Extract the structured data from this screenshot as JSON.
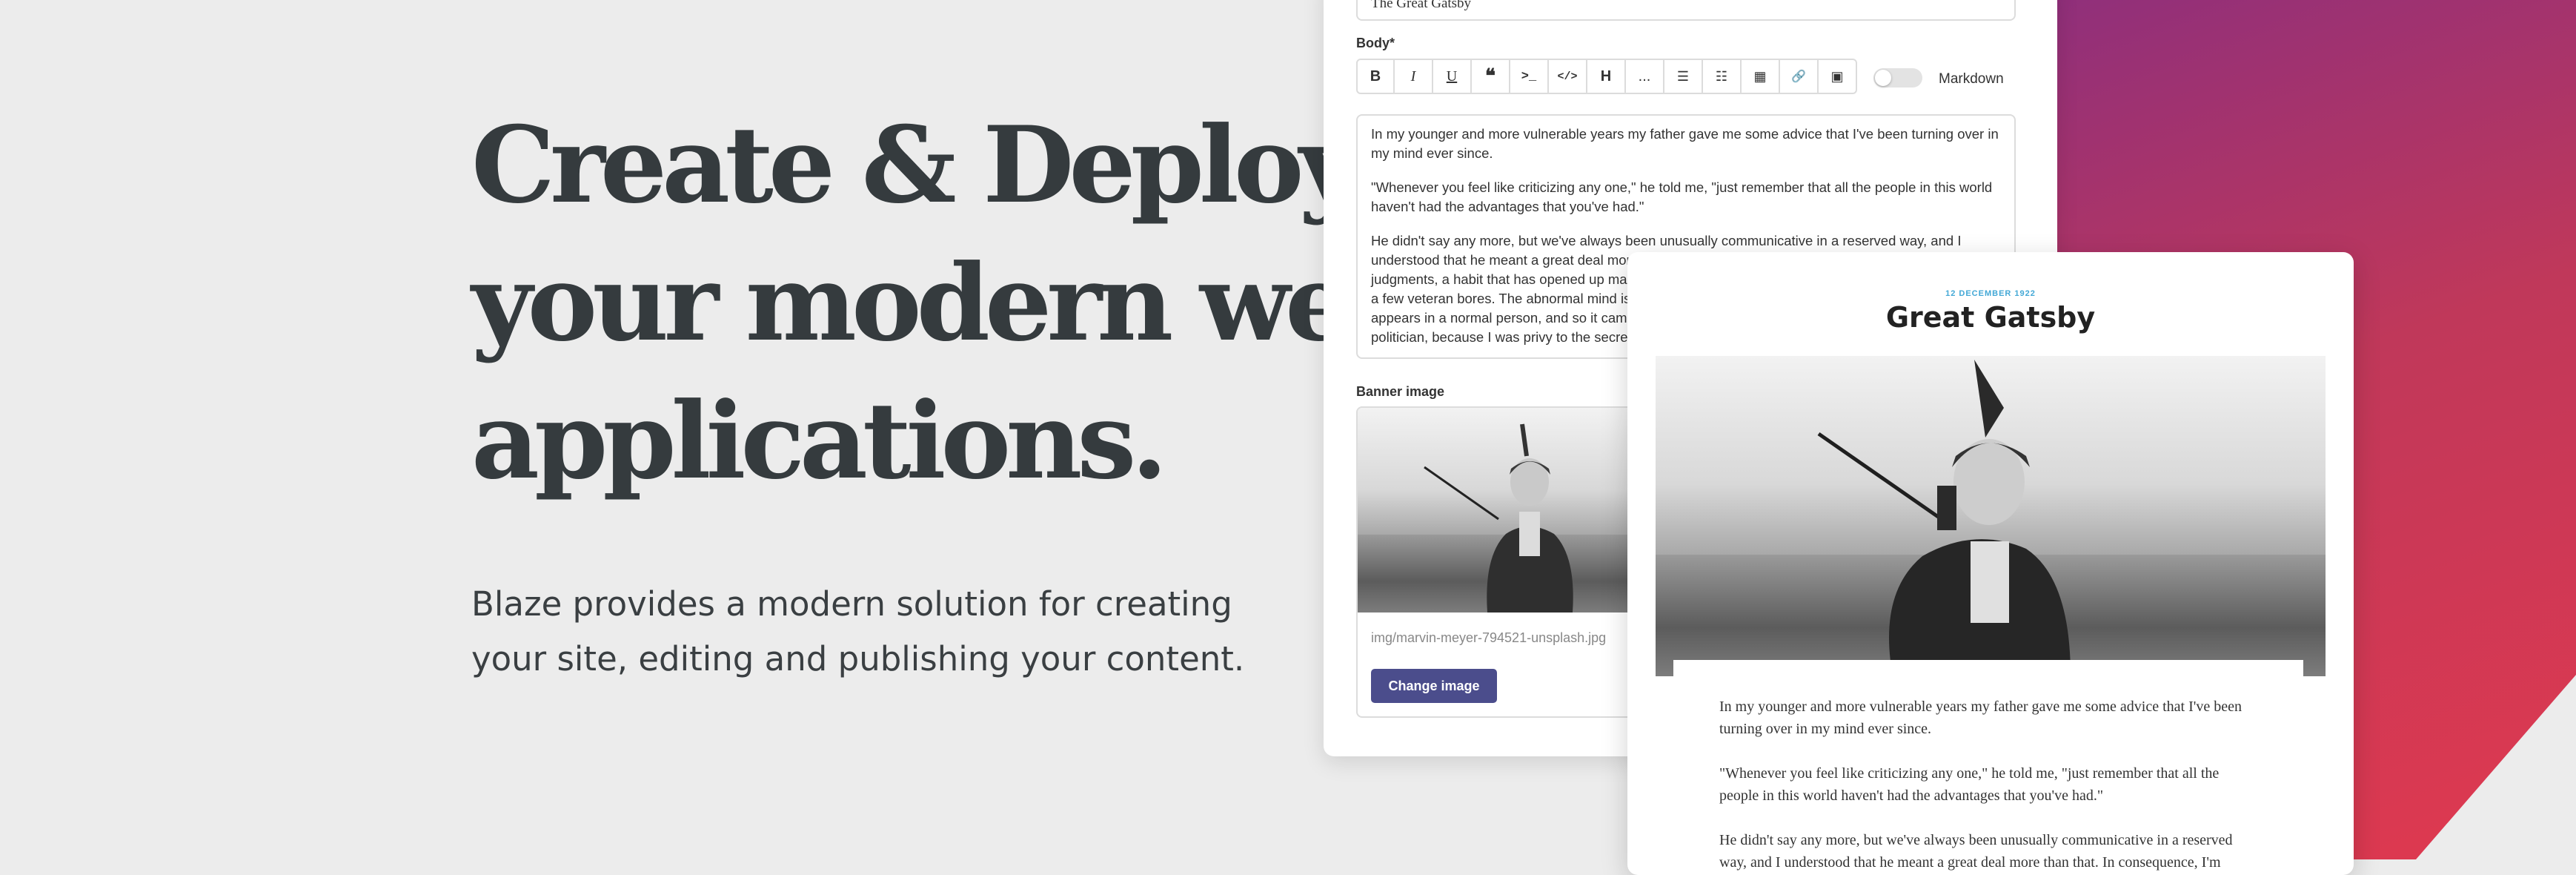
{
  "hero": {
    "title_lines": [
      "Create & Deploy",
      "your modern web",
      "applications."
    ],
    "subtitle": "Blaze provides a modern solution for creating your site, editing and publishing your content."
  },
  "editor": {
    "title_value": "The Great Gatsby",
    "body_label": "Body*",
    "toolbar": [
      {
        "label": "B",
        "icon": "bold-icon"
      },
      {
        "label": "I",
        "icon": "italic-icon"
      },
      {
        "label": "U",
        "icon": "underline-icon"
      },
      {
        "label": "❝",
        "icon": "quote-icon"
      },
      {
        "label": ">_",
        "icon": "code-block-icon"
      },
      {
        "label": "</>",
        "icon": "inline-code-icon"
      },
      {
        "label": "H",
        "icon": "heading-icon"
      },
      {
        "label": "...",
        "icon": "more-icon"
      },
      {
        "label": "☰",
        "icon": "ordered-list-icon"
      },
      {
        "label": "☷",
        "icon": "unordered-list-icon"
      },
      {
        "label": "▦",
        "icon": "table-icon"
      },
      {
        "label": "🔗",
        "icon": "link-icon"
      },
      {
        "label": "▣",
        "icon": "image-icon"
      }
    ],
    "markdown_label": "Markdown",
    "markdown_enabled": false,
    "body_paragraphs": [
      "In my younger and more vulnerable years my father gave me some advice that I've been turning over in my mind ever since.",
      "\"Whenever you feel like criticizing any one,\" he told me, \"just remember that all the people in this world haven't had the advantages that you've had.\"",
      "He didn't say any more, but we've always been unusually communicative in a reserved way, and I understood that he meant a great deal more than that. In consequence, I'm inclined to reserve all judgments, a habit that has opened up many curious natures to me and also made me the victim of not a few veteran bores. The abnormal mind is quick to detect and attach itself to this quality when it appears in a normal person, and so it came about that in college I was unjustly accused of being a politician, because I was privy to the secret griefs of wild, unknown men."
    ],
    "banner_label": "Banner image",
    "banner_path": "img/marvin-meyer-794521-unsplash.jpg",
    "change_image_label": "Change image"
  },
  "preview": {
    "date": "12 DECEMBER 1922",
    "title": "Great Gatsby",
    "paragraphs": [
      "In my younger and more vulnerable years my father gave me some advice that I've been turning over in my mind ever since.",
      "\"Whenever you feel like criticizing any one,\" he told me, \"just remember that all the people in this world haven't had the advantages that you've had.\"",
      "He didn't say any more, but we've always been unusually communicative in a reserved way, and I understood that he meant a great deal more than that. In consequence, I'm"
    ]
  },
  "colors": {
    "background": "#ececec",
    "heading": "#353b3e",
    "button": "#4b4d8c",
    "date_accent": "#43a8d6",
    "gradient_start": "#8e2f7c",
    "gradient_end": "#e0394f"
  }
}
